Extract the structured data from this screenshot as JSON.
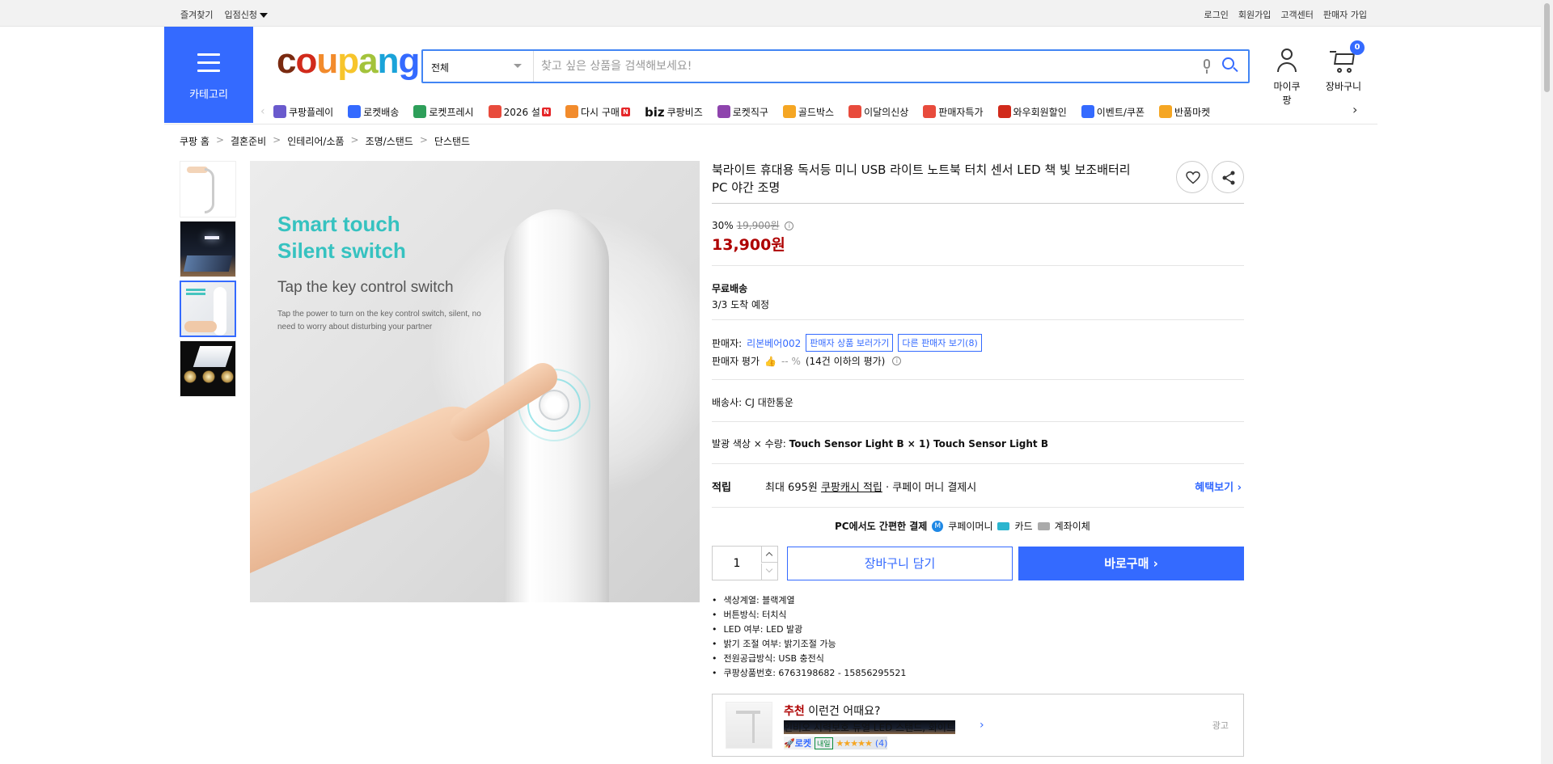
{
  "topbar": {
    "left": [
      "즐겨찾기",
      "입점신청"
    ],
    "right": [
      "로그인",
      "회원가입",
      "고객센터",
      "판매자 가입"
    ]
  },
  "header": {
    "category_label": "카테고리",
    "logo": [
      "c",
      "o",
      "u",
      "p",
      "a",
      "n",
      "g"
    ],
    "logo_colors": [
      "#7a2a10",
      "#d12a1b",
      "#f28b2c",
      "#f7c52c",
      "#a3c33b",
      "#1aa3d9",
      "#346aff"
    ],
    "search_category": "전체",
    "search_placeholder": "찾고 싶은 상품을 검색해보세요!",
    "mycoupang": "마이쿠팡",
    "cart": "장바구니",
    "cart_count": "0"
  },
  "nav": {
    "items": [
      {
        "label": "쿠팡플레이",
        "icon": "play-icon",
        "color": "#6a5acd"
      },
      {
        "label": "로켓배송",
        "icon": "rocket-icon",
        "color": "#346aff"
      },
      {
        "label": "로켓프레시",
        "icon": "rocket-fresh-icon",
        "color": "#2e9f5a"
      },
      {
        "label": "2026 설",
        "icon": "gift-icon",
        "color": "#e84b3c",
        "badge": "N"
      },
      {
        "label": "다시 구매",
        "icon": "house-icon",
        "color": "#f28b2c",
        "badge": "N"
      },
      {
        "label": "쿠팡비즈",
        "icon": "biz-icon",
        "color": "#333",
        "prefix": "biz"
      },
      {
        "label": "로켓직구",
        "icon": "globe-icon",
        "color": "#8e44ad"
      },
      {
        "label": "골드박스",
        "icon": "goldbox-icon",
        "color": "#f5a623"
      },
      {
        "label": "이달의신상",
        "icon": "new-bag-icon",
        "color": "#e84b3c"
      },
      {
        "label": "판매자특가",
        "icon": "percent-icon",
        "color": "#e84b3c"
      },
      {
        "label": "와우회원할인",
        "icon": "wow-icon",
        "color": "#d12a1b"
      },
      {
        "label": "이벤트/쿠폰",
        "icon": "coupon-icon",
        "color": "#346aff"
      },
      {
        "label": "반품마켓",
        "icon": "market-icon",
        "color": "#f5a623"
      }
    ]
  },
  "breadcrumb": [
    "쿠팡 홈",
    "결혼준비",
    "인테리어/소품",
    "조명/스탠드",
    "단스탠드"
  ],
  "gallery": {
    "headline": [
      "Smart touch",
      "Silent switch"
    ],
    "subhead": "Tap the key control switch",
    "caption": "Tap the power to turn on the key control switch, silent, no need to worry about disturbing your partner"
  },
  "product": {
    "title": "북라이트 휴대용 독서등 미니 USB 라이트 노트북 터치 센서 LED 책 빛 보조배터리 PC 야간 조명",
    "discount": "30%",
    "original_price": "19,900원",
    "price": "13,900원",
    "shipping": "무료배송",
    "arrival": "3/3 도착 예정",
    "seller_label": "판매자:",
    "seller_name": "리본베어002",
    "seller_products": "판매자 상품 보러가기",
    "other_sellers": "다른 판매자 보기(8)",
    "rating_label": "판매자 평가",
    "rating_value": "-- %",
    "rating_note": "(14건 이하의 평가)",
    "courier": "배송사:  CJ 대한통운",
    "option_label": "발광 색상 × 수량:",
    "option_value": "Touch Sensor Light B × 1) Touch Sensor Light B",
    "reward_label": "적립",
    "reward_prefix": "최대 695원",
    "reward_link": "쿠팡캐시 적립",
    "reward_suffix": "· 쿠페이 머니 결제시",
    "reward_more": "혜택보기",
    "pay_label": "PC에서도 간편한 결제",
    "pay_methods": [
      "쿠페이머니",
      "카드",
      "계좌이체"
    ],
    "quantity": "1",
    "add_cart": "장바구니 담기",
    "buy_now": "바로구매",
    "specs": [
      "색상계열: 블랙계열",
      "버튼방식: 터치식",
      "LED 여부: LED 발광",
      "밝기 조절 여부: 밝기조절 가능",
      "전원공급방식: USB 충전식",
      "쿠팡상품번호: 6763198682 - 15856295521"
    ]
  },
  "recommend": {
    "highlight": "추천",
    "title": "이런건 어때요?",
    "product": "인비오 시력보호 듀얼 LED 스탠드, 화이트",
    "rocket": "로켓",
    "tomorrow": "내일",
    "stars": "★★★★★",
    "count": "(4)",
    "ad": "광고"
  }
}
